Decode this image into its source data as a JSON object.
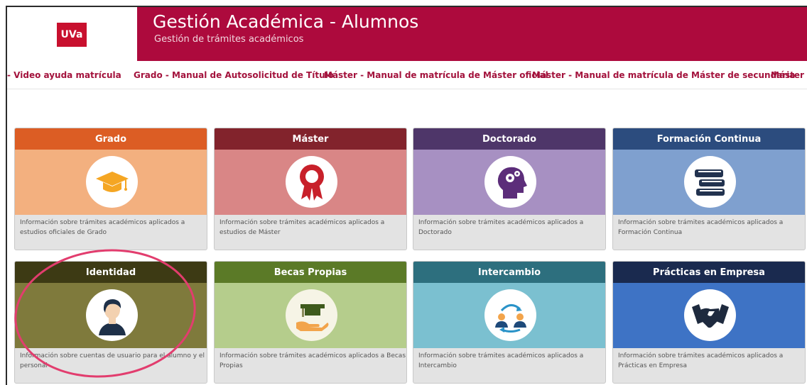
{
  "header": {
    "logo_text": "UVa",
    "title": "Gestión Académica - Alumnos",
    "subtitle": "Gestión de trámites académicos",
    "bg_color": "#ad0a3d"
  },
  "nav": {
    "links": [
      "- Video ayuda matrícula",
      "Grado - Manual de Autosolicitud de Título",
      "Máster - Manual de matrícula de Máster oficial",
      "Máster - Manual de matrícula de Máster de secundaria",
      "Máster - V"
    ]
  },
  "cards": [
    {
      "title": "Grado",
      "desc": "Información sobre trámites académicos aplicados a estudios oficiales de Grado",
      "icon": "graduation-cap-icon",
      "header_color": "#dc5d24",
      "band_color": "#f3b07f"
    },
    {
      "title": "Máster",
      "desc": "Información sobre trámites académicos aplicados a estudios de Máster",
      "icon": "award-ribbon-icon",
      "header_color": "#82232c",
      "band_color": "#d98686"
    },
    {
      "title": "Doctorado",
      "desc": "Información sobre trámites académicos aplicados a Doctorado",
      "icon": "head-gears-icon",
      "header_color": "#4e3669",
      "band_color": "#a790c2"
    },
    {
      "title": "Formación Continua",
      "desc": "Información sobre trámites académicos aplicados a Formación Continua",
      "icon": "books-icon",
      "header_color": "#2c4c7e",
      "band_color": "#7fa0cf"
    },
    {
      "title": "Identidad",
      "desc": "Información sobre cuentas de usuario para el alumno y el personal",
      "icon": "user-icon",
      "header_color": "#3d3a14",
      "band_color": "#7f7a3c"
    },
    {
      "title": "Becas Propias",
      "desc": "Información sobre trámites académicos aplicados a Becas Propias",
      "icon": "scholarship-hand-icon",
      "header_color": "#5b7a27",
      "band_color": "#b5cd8c"
    },
    {
      "title": "Intercambio",
      "desc": "Información sobre trámites académicos aplicados a Intercambio",
      "icon": "exchange-people-icon",
      "header_color": "#2d6f7e",
      "band_color": "#7bc0d0"
    },
    {
      "title": "Prácticas en Empresa",
      "desc": "Información sobre trámites académicos aplicados a Prácticas en Empresa",
      "icon": "handshake-icon",
      "header_color": "#1a2a4f",
      "band_color": "#3e73c5"
    }
  ],
  "highlight_color": "#e23d6e"
}
